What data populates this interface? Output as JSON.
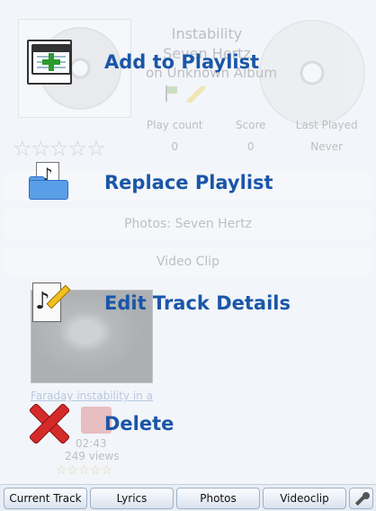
{
  "background": {
    "track_title": "Instability",
    "track_artist": "Seven Hertz",
    "track_album": "on Unknown Album",
    "stats": {
      "headers": [
        "Play count",
        "Score",
        "Last Played"
      ],
      "values": [
        "0",
        "0",
        "Never"
      ]
    },
    "rating_stars": "☆☆☆☆☆",
    "panels": {
      "photos": "Photos: Seven Hertz",
      "video": "Video Clip"
    },
    "video_result": {
      "title": "Faraday instability in a",
      "duration": "02:43",
      "views": "249 views",
      "stars": "☆☆☆☆☆"
    }
  },
  "menu": {
    "items": [
      {
        "label": "Add to Playlist",
        "icon": "add-playlist-icon"
      },
      {
        "label": "Replace Playlist",
        "icon": "replace-playlist-icon"
      },
      {
        "label": "Edit Track Details",
        "icon": "edit-track-icon"
      },
      {
        "label": "Delete",
        "icon": "delete-icon"
      }
    ],
    "accent": "#1a56a8"
  },
  "tabs": {
    "current_track": "Current Track",
    "lyrics": "Lyrics",
    "photos": "Photos",
    "videoclip": "Videoclip",
    "settings_icon": "wrench-icon"
  }
}
